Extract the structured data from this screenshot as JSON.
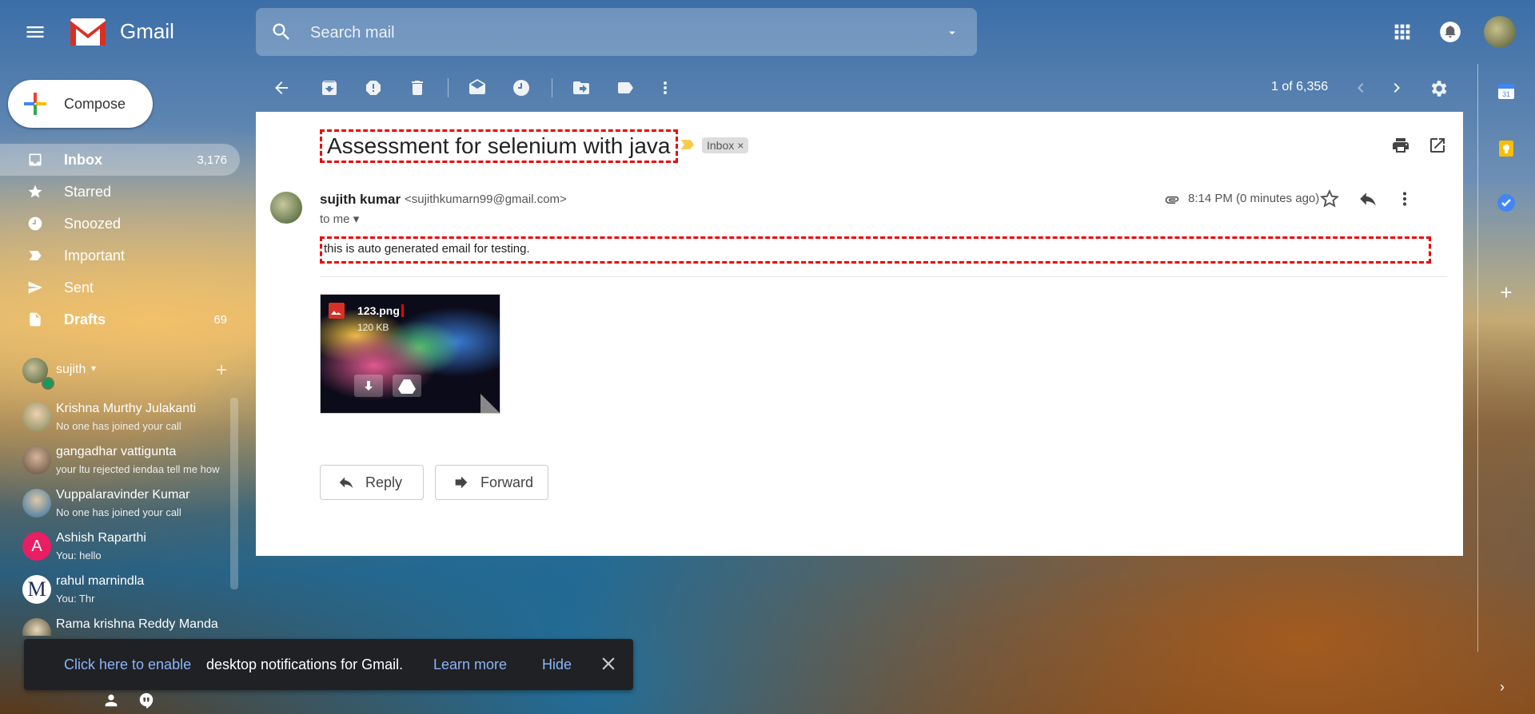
{
  "header": {
    "app_name": "Gmail",
    "search_placeholder": "Search mail"
  },
  "compose": {
    "label": "Compose"
  },
  "nav": {
    "items": [
      {
        "label": "Inbox",
        "count": "3,176",
        "icon": "inbox-icon"
      },
      {
        "label": "Starred",
        "count": "",
        "icon": "star-icon"
      },
      {
        "label": "Snoozed",
        "count": "",
        "icon": "clock-icon"
      },
      {
        "label": "Important",
        "count": "",
        "icon": "label-important-icon"
      },
      {
        "label": "Sent",
        "count": "",
        "icon": "send-icon"
      },
      {
        "label": "Drafts",
        "count": "69",
        "icon": "draft-icon"
      }
    ]
  },
  "hangouts": {
    "user": "sujith",
    "contacts": [
      {
        "name": "Krishna Murthy Julakanti",
        "status": "No one has joined your call"
      },
      {
        "name": "gangadhar vattigunta",
        "status": "your ltu rejected iendaa tell me how"
      },
      {
        "name": "Vuppalaravinder Kumar",
        "status": "No one has joined your call"
      },
      {
        "name": "Ashish Raparthi",
        "status": "You: hello",
        "initial": "A"
      },
      {
        "name": "rahul marnindla",
        "status": "You: Thr",
        "initial": "M"
      },
      {
        "name": "Rama krishna Reddy Manda",
        "status": ""
      }
    ]
  },
  "toolbar": {
    "pager": "1 of 6,356"
  },
  "email": {
    "subject": "Assessment for selenium with java",
    "label": "Inbox",
    "sender_name": "sujith kumar",
    "sender_email": "<sujithkumarn99@gmail.com>",
    "to": "to me",
    "time": "8:14 PM (0 minutes ago)",
    "body": "this is auto generated email for testing.",
    "attachment": {
      "name": "123.png",
      "size": "120 KB"
    },
    "reply_label": "Reply",
    "forward_label": "Forward"
  },
  "side_panel": {
    "calendar_day": "31"
  },
  "notification": {
    "enable_link": "Click here to enable",
    "text": "desktop notifications for Gmail.",
    "learn_more": "Learn more",
    "hide": "Hide"
  },
  "colors": {
    "accent_red": "#d93025",
    "link_blue": "#8ab4f8",
    "annotation_red": "#ee0000"
  }
}
